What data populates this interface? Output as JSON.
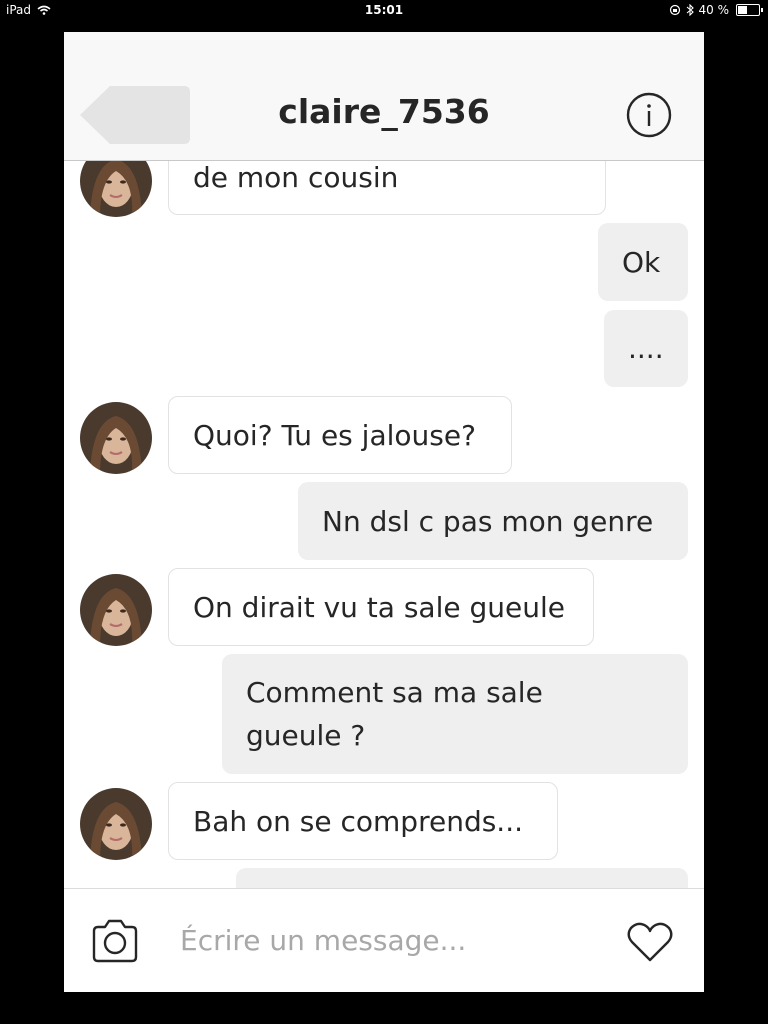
{
  "status_bar": {
    "device": "iPad",
    "time": "15:01",
    "battery": "40 %",
    "battery_level": 0.4
  },
  "header": {
    "title": "claire_7536",
    "info_icon": "info-icon",
    "back_icon": "back-arrow-icon"
  },
  "messages": [
    {
      "from": "them",
      "text": "de mon cousin"
    },
    {
      "from": "me",
      "text": "Ok"
    },
    {
      "from": "me",
      "text": "...."
    },
    {
      "from": "them",
      "text": "Quoi? Tu es jalouse?"
    },
    {
      "from": "me",
      "text": "Nn dsl c pas mon genre"
    },
    {
      "from": "them",
      "text": "On dirait vu ta sale gueule"
    },
    {
      "from": "me",
      "text": "Comment sa ma sale gueule ?"
    },
    {
      "from": "them",
      "text": "Bah on se comprends..."
    },
    {
      "from": "me",
      "text": ""
    }
  ],
  "composer": {
    "placeholder": "Écrire un message...",
    "camera_icon": "camera-icon",
    "heart_icon": "heart-icon"
  },
  "colors": {
    "incoming_bubble_bg": "#ffffff",
    "incoming_bubble_border": "#e2e2e2",
    "outgoing_bubble_bg": "#efefef",
    "text": "#262626",
    "placeholder": "#a8a8a8"
  }
}
